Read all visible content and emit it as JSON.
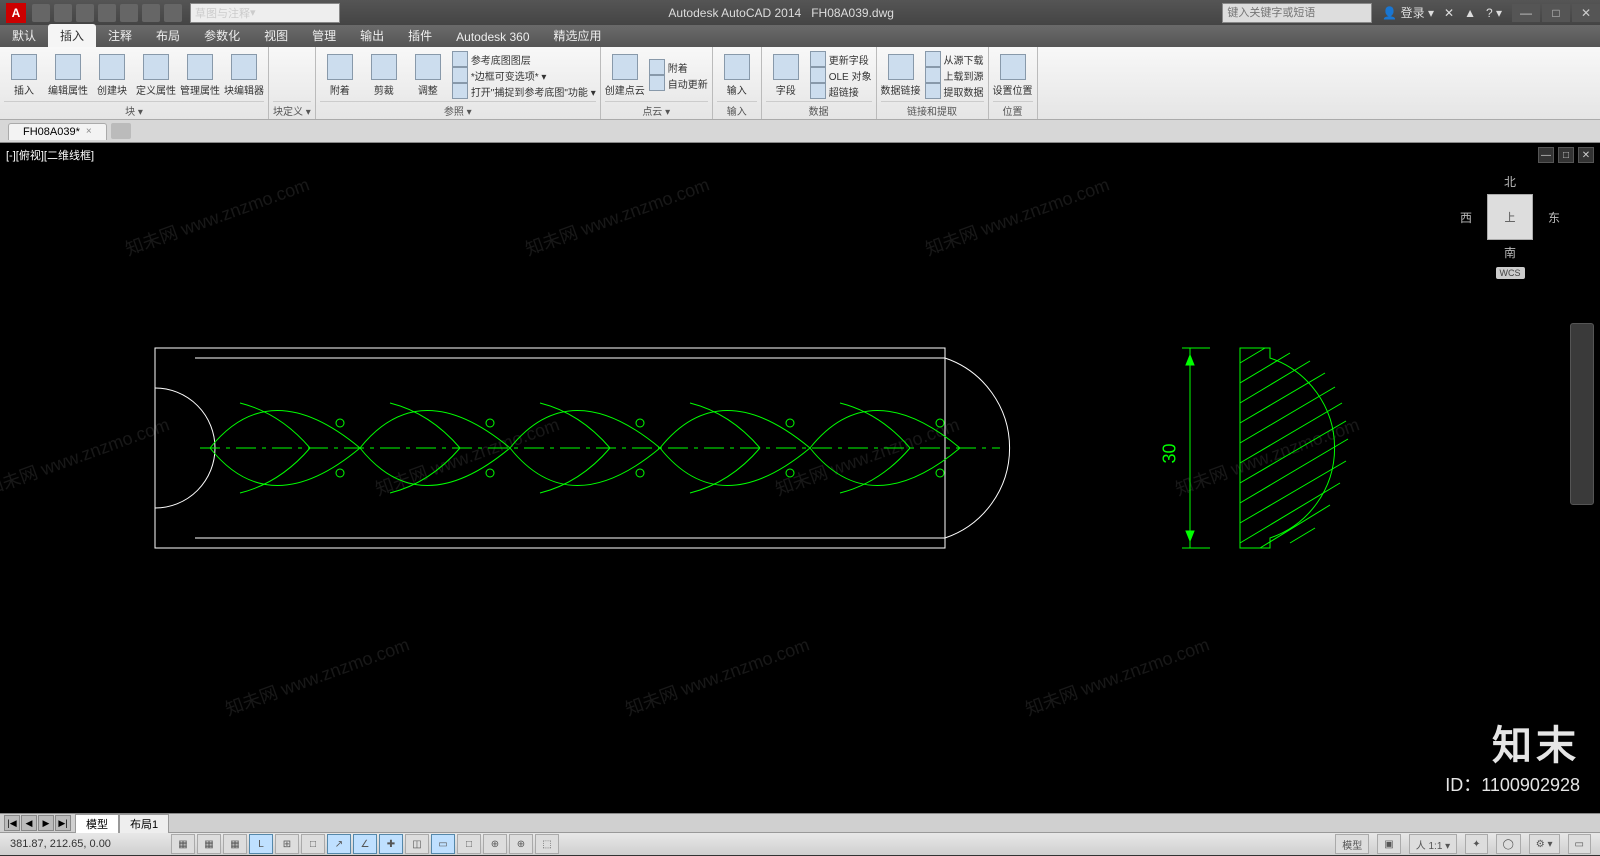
{
  "title": {
    "app": "Autodesk AutoCAD 2014",
    "file": "FH08A039.dwg"
  },
  "qat_workspace": "草图与注释",
  "search_placeholder": "键入关键字或短语",
  "signin": "登录",
  "window_buttons": {
    "min": "—",
    "max": "□",
    "close": "✕"
  },
  "menubar": [
    "默认",
    "插入",
    "注释",
    "布局",
    "参数化",
    "视图",
    "管理",
    "输出",
    "插件",
    "Autodesk 360",
    "精选应用"
  ],
  "menubar_active": 1,
  "ribbon": {
    "panels": [
      {
        "title": "块 ▾",
        "items": [
          {
            "t": "big",
            "label": "插入"
          },
          {
            "t": "big",
            "label": "编辑属性"
          },
          {
            "t": "big",
            "label": "创建块"
          },
          {
            "t": "big",
            "label": "定义属性"
          },
          {
            "t": "big",
            "label": "管理属性"
          },
          {
            "t": "big",
            "label": "块编辑器"
          }
        ]
      },
      {
        "title": "块定义 ▾",
        "items": []
      },
      {
        "title": "参照 ▾",
        "items": [
          {
            "t": "big",
            "label": "附着"
          },
          {
            "t": "big",
            "label": "剪裁"
          },
          {
            "t": "big",
            "label": "调整"
          },
          {
            "t": "sm",
            "rows": [
              "参考底图图层",
              "*边框可变选项* ▾",
              "打开\"捕捉到参考底图\"功能 ▾"
            ]
          }
        ]
      },
      {
        "title": "点云 ▾",
        "items": [
          {
            "t": "big",
            "label": "创建点云"
          },
          {
            "t": "sm",
            "rows": [
              "附着",
              "自动更新"
            ]
          }
        ]
      },
      {
        "title": "输入",
        "items": [
          {
            "t": "big",
            "label": "输入"
          }
        ]
      },
      {
        "title": "数据",
        "items": [
          {
            "t": "big",
            "label": "字段"
          },
          {
            "t": "sm",
            "rows": [
              "更新字段",
              "OLE 对象",
              "超链接"
            ]
          }
        ]
      },
      {
        "title": "链接和提取",
        "items": [
          {
            "t": "big",
            "label": "数据链接"
          },
          {
            "t": "sm",
            "rows": [
              "从源下载",
              "上载到源",
              "提取数据"
            ]
          }
        ]
      },
      {
        "title": "位置",
        "items": [
          {
            "t": "big",
            "label": "设置位置"
          }
        ]
      }
    ]
  },
  "filetab": {
    "name": "FH08A039*",
    "close": "×"
  },
  "viewport": {
    "label": "[-][俯视][二维线框]",
    "min": "—",
    "max": "□",
    "close": "✕"
  },
  "viewcube": {
    "n": "北",
    "s": "南",
    "e": "东",
    "w": "西",
    "top": "上",
    "wcs": "WCS"
  },
  "dimension": "30",
  "overlay": {
    "brand": "知末",
    "id": "ID：1100902928"
  },
  "watermark": "知未网 www.znzmo.com",
  "layout": {
    "nav": [
      "|◀",
      "◀",
      "▶",
      "▶|"
    ],
    "tabs": [
      "模型",
      "布局1"
    ],
    "active": 0
  },
  "status": {
    "coords": "381.87, 212.65, 0.00",
    "buttons": [
      "▦",
      "▦",
      "▦",
      "L",
      "⊞",
      "□",
      "↗",
      "∠",
      "✚",
      "◫",
      "▭",
      "□",
      "⊕",
      "⊕",
      "⬚"
    ],
    "on": [
      3,
      6,
      7,
      8,
      10
    ],
    "right": [
      "模型",
      "▣",
      "人 1:1 ▾",
      "✦",
      "◯",
      "⚙ ▾",
      "▭"
    ]
  }
}
